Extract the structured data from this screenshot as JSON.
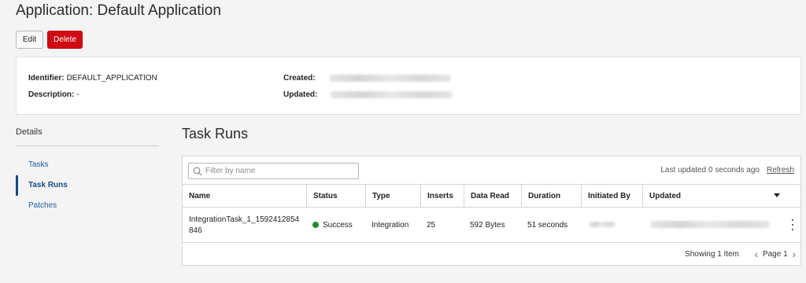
{
  "page": {
    "title": "Application: Default Application"
  },
  "toolbar": {
    "edit_label": "Edit",
    "delete_label": "Delete"
  },
  "info": {
    "identifier_label": "Identifier:",
    "identifier_value": "DEFAULT_APPLICATION",
    "description_label": "Description:",
    "description_value": "-",
    "created_label": "Created:",
    "updated_label": "Updated:"
  },
  "sidenav": {
    "heading": "Details",
    "items": [
      {
        "label": "Tasks",
        "active": false
      },
      {
        "label": "Task Runs",
        "active": true
      },
      {
        "label": "Patches",
        "active": false
      }
    ]
  },
  "task_runs": {
    "title": "Task Runs",
    "filter_placeholder": "Filter by name",
    "last_updated": "Last updated 0 seconds ago",
    "refresh_label": "Refresh",
    "columns": [
      "Name",
      "Status",
      "Type",
      "Inserts",
      "Data Read",
      "Duration",
      "Initiated By",
      "Updated"
    ],
    "rows": [
      {
        "name": "IntegrationTask_1_1592412854846",
        "name_line1": "IntegrationTask_1_1592412854",
        "name_line2": "846",
        "status": "Success",
        "type": "Integration",
        "inserts": "25",
        "data_read": "592 Bytes",
        "duration": "51 seconds"
      }
    ],
    "showing": "Showing 1 Item",
    "page_label": "Page 1"
  },
  "colors": {
    "delete_button": "#d00a12",
    "success_dot": "#1f8a2e",
    "link": "#1c5fa8"
  },
  "icons": {
    "filter": "search-icon",
    "sort": "caret-down-icon",
    "row_actions": "kebab-menu-icon",
    "prev": "chevron-left-icon",
    "next": "chevron-right-icon"
  }
}
